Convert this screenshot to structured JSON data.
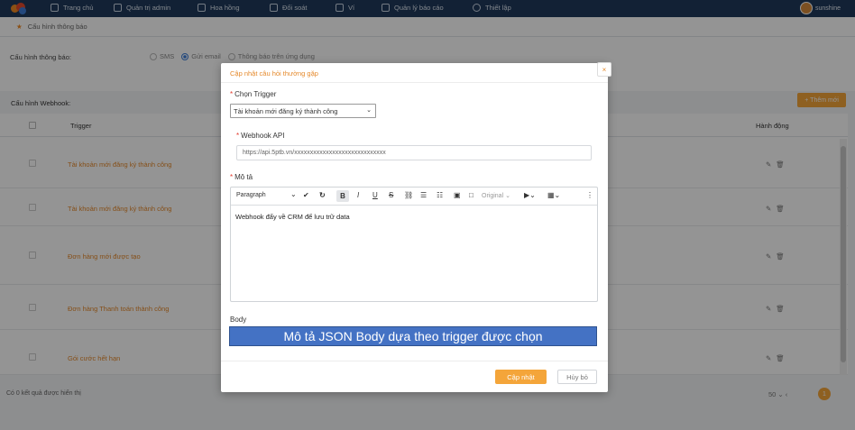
{
  "nav": {
    "items": [
      "Trang chủ",
      "Quản trị admin",
      "Hoa hồng",
      "Đối soát",
      "Ví",
      "Quản lý báo cáo",
      "Thiết lập"
    ],
    "user": "sunshine"
  },
  "breadcrumb": "Cấu hình thông báo",
  "settings": {
    "label": "Cấu hình thông báo:",
    "options": [
      "SMS",
      "Gửi email",
      "Thông báo trên ứng dụng"
    ],
    "selected": "Gửi email"
  },
  "webhook": {
    "title": "Cấu hình Webhook:",
    "add_button": "+ Thêm mới",
    "columns": {
      "trigger": "Trigger",
      "action": "Hành động"
    },
    "rows": [
      {
        "trigger": "Tài khoản mới đăng ký thành công"
      },
      {
        "trigger": "Tài khoản mới đăng ký thành công"
      },
      {
        "trigger": "Đơn hàng mới được tạo"
      },
      {
        "trigger": "Đơn hàng Thanh toán thành công"
      },
      {
        "trigger": "Gói cước hết hạn"
      }
    ],
    "action_icons": [
      "edit-icon",
      "delete-icon"
    ]
  },
  "footer": {
    "count": "Có 0 kết quả được hiển thị",
    "page_size": "50",
    "page": "1"
  },
  "modal": {
    "title": "Cập nhật câu hỏi thường gặp",
    "close": "×",
    "trigger_label": "Chọn Trigger",
    "trigger_value": "Tài khoản mới đăng ký thành công",
    "api_label": "Webhook API",
    "api_value": "https://api.5ptb.vn/xxxxxxxxxxxxxxxxxxxxxxxxxxxxx",
    "desc_label": "Mô tả",
    "toolbar": {
      "paragraph": "Paragraph",
      "image_size": "Original"
    },
    "desc_content": "Webhook đẩy về CRM để lưu trữ data",
    "body_label": "Body",
    "body_banner": "Mô tả JSON Body dựa theo trigger được chọn",
    "save": "Cập nhật",
    "cancel": "Hủy bỏ"
  },
  "colors": {
    "accent": "#f4a53a",
    "nav_bg": "#1f3a5c",
    "banner": "#4472c4"
  }
}
